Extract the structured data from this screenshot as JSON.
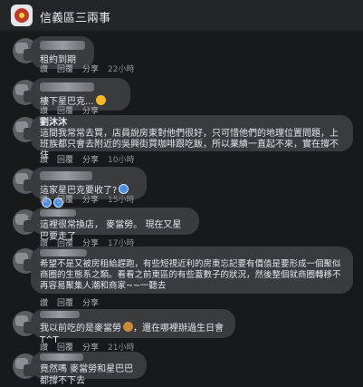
{
  "group": {
    "name": "信義區三兩事"
  },
  "colors": {
    "background": "#18191a",
    "bubble": "#3a3b3c",
    "secondary_text": "#b0b3b8"
  },
  "action_labels": {
    "like": "讚",
    "reply": "回覆",
    "share": "分享"
  },
  "comments": [
    {
      "author": "",
      "text": "租約到期",
      "time": "22小時"
    },
    {
      "author": "",
      "text": "樓下星巴克...",
      "emoji": "sad-face-icon",
      "time": ""
    },
    {
      "author": "劉沐沐",
      "text": "這間我常常去買，店員說房東對他們很好，只可惜他們的地理位置問題，上班族都只會去附近的吳興街買咖啡跟吃飯，所以業績一直起不來，實在撐不住",
      "time": "10小時"
    },
    {
      "author": "",
      "text": "這家星巴克要收了?",
      "emoji": "shocked-face-icon",
      "time": "15小時"
    },
    {
      "author": "",
      "text": "這裡很常換店， 麥當勞。 現在又星巴要走了",
      "time": "17小時"
    },
    {
      "author": "",
      "text": "希望不是又被房租給趕跑，有些短視近利的房東忘記要有價值是要形成一個聚似商圈的生態系之類。看看之前東區的有些蓋數子的狀況，然後整個就商圈轉移不再容易聚集人潮和商家~~一聽去",
      "time": ""
    },
    {
      "author": "",
      "text": "我以前吃的是麥當勞",
      "emoji": "burger-icon",
      "text2": "，還在哪裡辦過生日會T^T",
      "time": "21小時"
    },
    {
      "author": "",
      "text": "竟然嗎 麥當勞和星巴巴都撐不下去",
      "time": ""
    }
  ]
}
